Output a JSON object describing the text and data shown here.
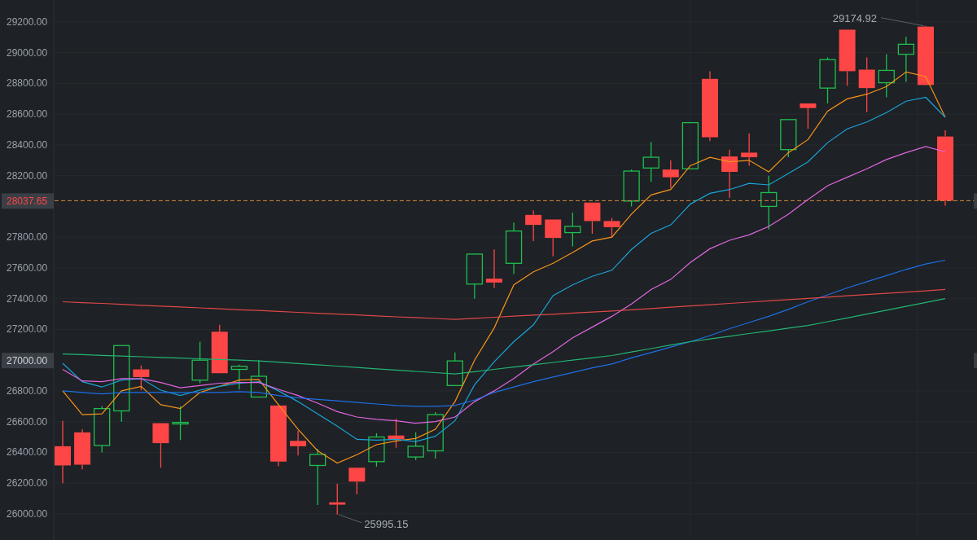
{
  "chart_data": {
    "type": "line",
    "ylim": [
      25830,
      29343
    ],
    "grid": true,
    "yticks": [
      {
        "value": 26000,
        "label": "26000.00"
      },
      {
        "value": 26200,
        "label": "26200.00"
      },
      {
        "value": 26400,
        "label": "26400.00"
      },
      {
        "value": 26600,
        "label": "26600.00"
      },
      {
        "value": 26800,
        "label": "26800.00"
      },
      {
        "value": 27200,
        "label": "27200.00"
      },
      {
        "value": 27400,
        "label": "27400.00"
      },
      {
        "value": 27600,
        "label": "27600.00"
      },
      {
        "value": 27800,
        "label": "27800.00"
      },
      {
        "value": 28200,
        "label": "28200.00"
      },
      {
        "value": 28400,
        "label": "28400.00"
      },
      {
        "value": 28600,
        "label": "28600.00"
      },
      {
        "value": 28800,
        "label": "28800.00"
      },
      {
        "value": 29000,
        "label": "29000.00"
      },
      {
        "value": 29200,
        "label": "29200.00"
      }
    ],
    "series": [
      {
        "color": "#f7931a",
        "values": [
          26800,
          26645,
          26650,
          26800,
          26830,
          26710,
          26685,
          26790,
          26830,
          26870,
          26875,
          26710,
          26550,
          26410,
          26330,
          26385,
          26450,
          26475,
          26490,
          26550,
          26730,
          27000,
          27210,
          27490,
          27575,
          27630,
          27700,
          27775,
          27800,
          27950,
          28075,
          28110,
          28265,
          28320,
          28290,
          28300,
          28225,
          28350,
          28435,
          28620,
          28700,
          28730,
          28780,
          28875,
          28845,
          28580
        ]
      },
      {
        "color": "#1aa3d9",
        "values": [
          26980,
          26860,
          26825,
          26870,
          26880,
          26805,
          26770,
          26805,
          26830,
          26850,
          26860,
          26800,
          26730,
          26650,
          26570,
          26485,
          26480,
          26485,
          26470,
          26505,
          26605,
          26840,
          26990,
          27120,
          27230,
          27420,
          27490,
          27545,
          27585,
          27720,
          27825,
          27880,
          28015,
          28085,
          28110,
          28150,
          28140,
          28215,
          28290,
          28415,
          28505,
          28550,
          28610,
          28685,
          28710,
          28580
        ]
      },
      {
        "color": "#e066e0",
        "values": [
          26940,
          26865,
          26860,
          26880,
          26880,
          26855,
          26820,
          26835,
          26850,
          26855,
          26855,
          26810,
          26770,
          26720,
          26665,
          26630,
          26615,
          26605,
          26590,
          26600,
          26630,
          26730,
          26800,
          26880,
          26975,
          27055,
          27145,
          27215,
          27285,
          27365,
          27460,
          27525,
          27635,
          27725,
          27780,
          27815,
          27870,
          27950,
          28045,
          28135,
          28190,
          28245,
          28305,
          28350,
          28390,
          28355
        ]
      },
      {
        "color": "#1e6fe6",
        "values": [
          26800,
          26790,
          26780,
          26790,
          26790,
          26790,
          26790,
          26790,
          26790,
          26795,
          26790,
          26770,
          26755,
          26745,
          26735,
          26725,
          26715,
          26705,
          26700,
          26700,
          26705,
          26740,
          26790,
          26825,
          26860,
          26890,
          26920,
          26950,
          26975,
          27015,
          27050,
          27085,
          27120,
          27160,
          27205,
          27245,
          27285,
          27330,
          27380,
          27425,
          27470,
          27510,
          27550,
          27590,
          27625,
          27650
        ]
      },
      {
        "color": "#e04848",
        "values": [
          27380,
          27374,
          27369,
          27363,
          27357,
          27351,
          27346,
          27340,
          27334,
          27328,
          27323,
          27317,
          27311,
          27305,
          27300,
          27294,
          27288,
          27282,
          27277,
          27271,
          27265,
          27272,
          27279,
          27286,
          27293,
          27299,
          27306,
          27313,
          27320,
          27328,
          27336,
          27345,
          27353,
          27361,
          27369,
          27377,
          27386,
          27394,
          27402,
          27410,
          27419,
          27427,
          27435,
          27443,
          27451,
          27460
        ]
      },
      {
        "color": "#22b573",
        "values": [
          27040,
          27036,
          27031,
          27027,
          27022,
          27018,
          27013,
          27009,
          27004,
          27000,
          26995,
          26987,
          26978,
          26970,
          26961,
          26953,
          26944,
          26936,
          26927,
          26919,
          26910,
          26925,
          26940,
          26955,
          26970,
          26985,
          27000,
          27015,
          27030,
          27053,
          27075,
          27098,
          27120,
          27138,
          27155,
          27173,
          27190,
          27208,
          27225,
          27250,
          27275,
          27300,
          27325,
          27350,
          27375,
          27400
        ]
      }
    ],
    "annotations": [
      "29174.92",
      "25995.15",
      "28037.65",
      "27000.00"
    ]
  }
}
